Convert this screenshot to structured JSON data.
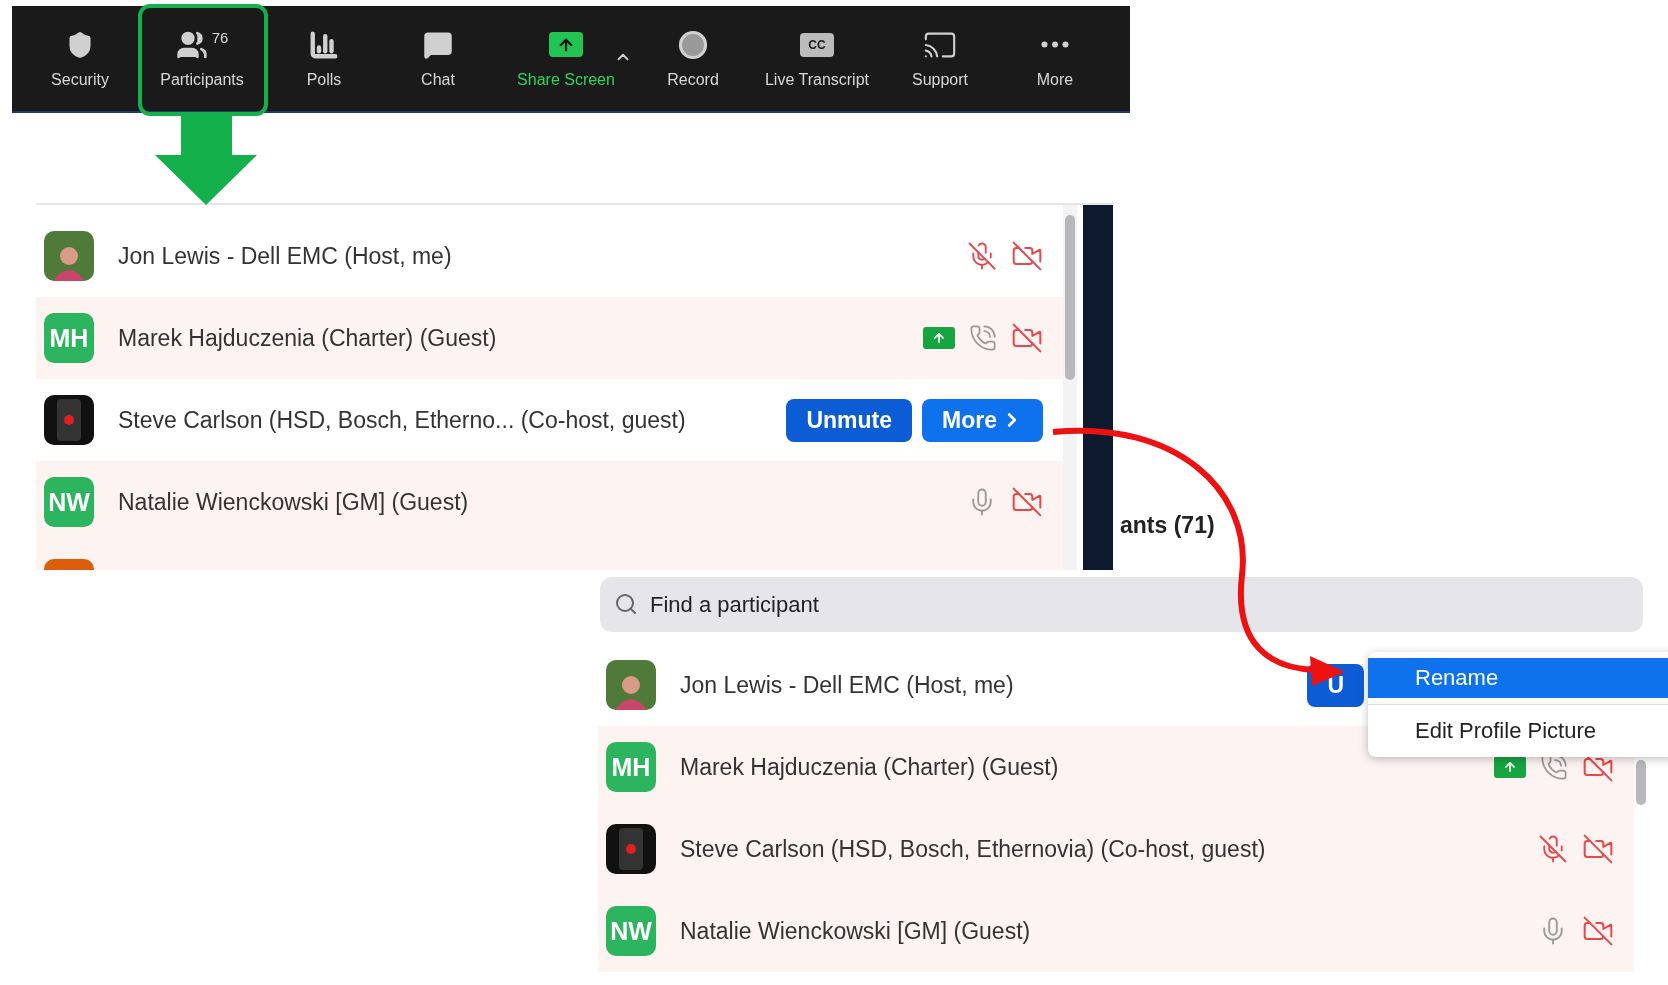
{
  "toolbar": {
    "items": [
      {
        "kind": "security",
        "label": "Security",
        "highlighted": false
      },
      {
        "kind": "participants",
        "label": "Participants",
        "count": "76",
        "highlighted": true
      },
      {
        "kind": "polls",
        "label": "Polls",
        "highlighted": false
      },
      {
        "kind": "chat",
        "label": "Chat",
        "highlighted": false
      },
      {
        "kind": "share",
        "label": "Share Screen",
        "highlighted": false
      },
      {
        "kind": "record",
        "label": "Record",
        "highlighted": false
      },
      {
        "kind": "transcript",
        "label": "Live Transcript",
        "icon_text": "CC",
        "highlighted": false
      },
      {
        "kind": "support",
        "label": "Support",
        "highlighted": false
      },
      {
        "kind": "more",
        "label": "More",
        "highlighted": false
      }
    ]
  },
  "panel_top": {
    "rows": [
      {
        "avatar": {
          "kind": "photo"
        },
        "name": "Jon Lewis - Dell EMC (Host, me)",
        "tinted": false,
        "muted": true,
        "phone": false,
        "video_on": false,
        "sharing": false
      },
      {
        "avatar": {
          "kind": "initials",
          "text": "MH",
          "color": "#2db45e"
        },
        "name": "Marek Hajduczenia (Charter) (Guest)",
        "tinted": true,
        "phone": true,
        "video_on": false,
        "sharing": true
      },
      {
        "avatar": {
          "kind": "device"
        },
        "name": "Steve Carlson (HSD, Bosch, Etherno...  (Co-host, guest)",
        "tinted": false,
        "buttons": [
          "Unmute",
          "More"
        ]
      },
      {
        "avatar": {
          "kind": "initials",
          "text": "NW",
          "color": "#2db45e"
        },
        "name": "Natalie Wienckowski [GM] (Guest)",
        "tinted": true,
        "muted": false,
        "phone": false,
        "video_on": false,
        "sharing": false
      },
      {
        "avatar": {
          "kind": "initials",
          "color": "#dd5d0c"
        },
        "tinted": true
      }
    ]
  },
  "panel_bottom": {
    "title": "ants (71)",
    "search": {
      "placeholder": "Find a participant"
    },
    "rows": [
      {
        "avatar": {
          "kind": "photo"
        },
        "name": "Jon Lewis - Dell EMC (Host, me)",
        "tinted": false,
        "buttons": [
          "U"
        ]
      },
      {
        "avatar": {
          "kind": "initials",
          "text": "MH",
          "color": "#2db45e"
        },
        "name": "Marek Hajduczenia (Charter) (Guest)",
        "tinted": true,
        "phone": true,
        "video_on": false,
        "sharing": true
      },
      {
        "avatar": {
          "kind": "device"
        },
        "name": "Steve Carlson (HSD, Bosch, Ethernovia) (Co-host, guest)",
        "tinted": true,
        "muted": true,
        "phone": false,
        "video_on": false,
        "sharing": false
      },
      {
        "avatar": {
          "kind": "initials",
          "text": "NW",
          "color": "#2db45e"
        },
        "name": "Natalie Wienckowski [GM] (Guest)",
        "tinted": true,
        "muted": false,
        "phone": false,
        "video_on": false,
        "sharing": false
      }
    ],
    "menu": {
      "items": [
        {
          "label": "Rename",
          "selected": true
        },
        {
          "label": "Edit Profile Picture",
          "selected": false
        }
      ]
    }
  }
}
